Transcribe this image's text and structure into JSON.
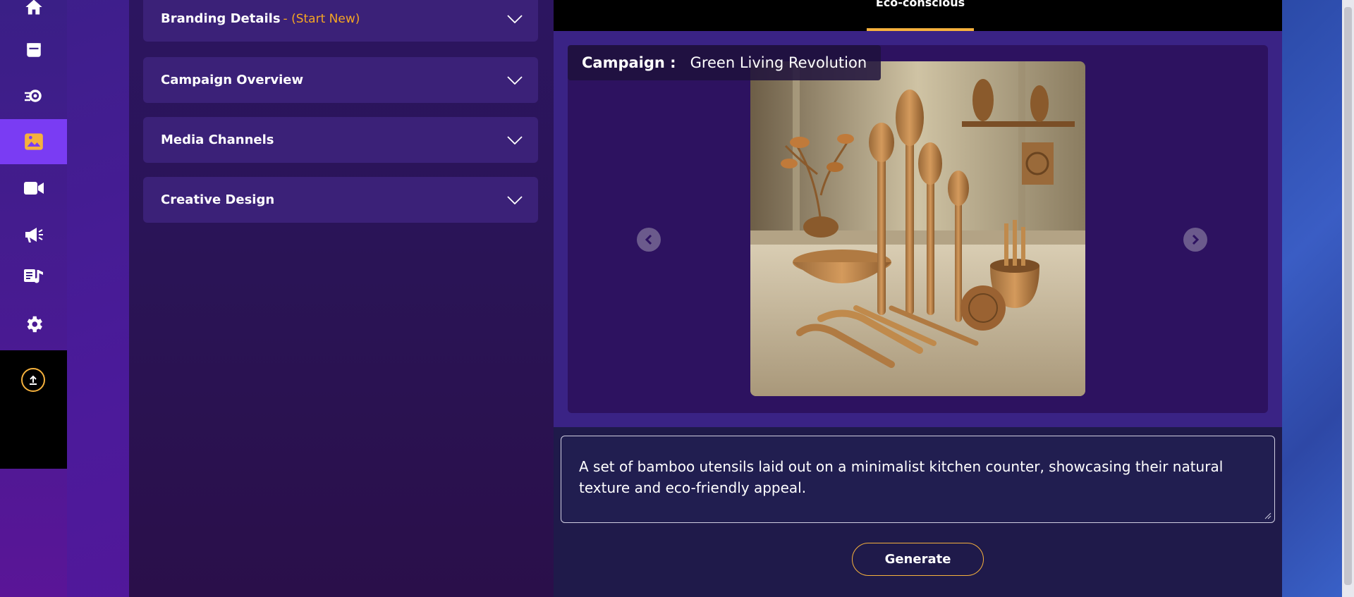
{
  "sidebar": {
    "items": [
      {
        "icon": "home-icon"
      },
      {
        "icon": "calendar-icon"
      },
      {
        "icon": "gear-flow-icon"
      },
      {
        "icon": "image-icon",
        "active": true
      },
      {
        "icon": "video-icon"
      },
      {
        "icon": "megaphone-icon"
      },
      {
        "icon": "music-note-icon"
      },
      {
        "icon": "settings-icon"
      }
    ],
    "upload_icon": "upload-icon"
  },
  "accordions": [
    {
      "title": "Branding Details",
      "subtitle": "- (Start New)"
    },
    {
      "title": "Campaign Overview",
      "subtitle": ""
    },
    {
      "title": "Media Channels",
      "subtitle": ""
    },
    {
      "title": "Creative Design",
      "subtitle": ""
    }
  ],
  "tabs": {
    "active_label": "Eco-conscious"
  },
  "campaign": {
    "label": "Campaign :",
    "name": "Green Living Revolution"
  },
  "prompt": {
    "value": "A set of bamboo utensils laid out on a minimalist kitchen counter, showcasing their natural texture and eco-friendly appeal."
  },
  "actions": {
    "generate_label": "Generate"
  },
  "colors": {
    "accent": "#f5b13d",
    "active_nav": "#7a3cf3"
  }
}
